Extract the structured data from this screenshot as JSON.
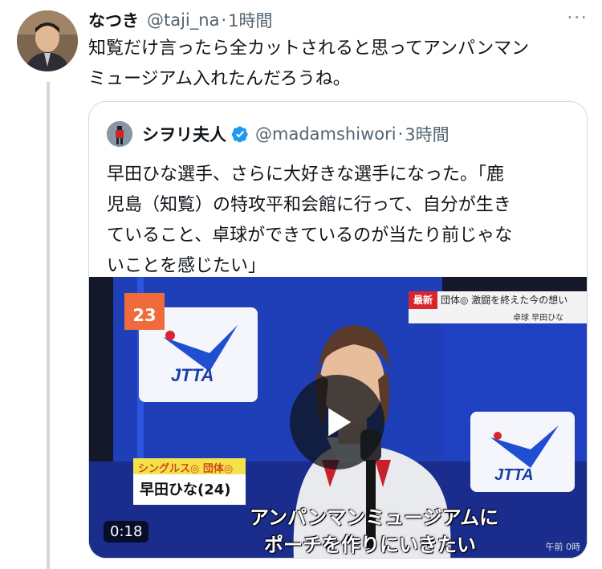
{
  "tweet": {
    "display_name": "なつき",
    "handle": "@taji_na",
    "separator": "·",
    "time": "1時間",
    "more_label": "···",
    "text_line1": "知覧だけ言ったら全カットされると思ってアンパンマン",
    "text_line2": "ミュージアム入れたんだろうね。"
  },
  "quote": {
    "display_name": "シヲリ夫人",
    "handle": "@madamshiwori",
    "separator": "·",
    "time": "3時間",
    "text_line1": "早田ひな選手、さらに大好きな選手になった。「鹿",
    "text_line2": "児島（知覧）の特攻平和会館に行って、自分が生き",
    "text_line3": "ていること、卓球ができているのが当たり前じゃな",
    "text_line4": "いことを感じたい」",
    "media": {
      "duration": "0:18",
      "subtitle_line1": "アンパンマンミュージアムに",
      "subtitle_line2": "ポーチを作りにいきたい",
      "name_plate_top": "シングルス◎ 団体◎",
      "name_plate": "早田ひな(24)",
      "badge": "23",
      "news_tag": "最新",
      "news_text": "団体◎ 激闘を終えた今の想い",
      "news_sub": "卓球 早田ひな",
      "logo_text": "JTTA",
      "corner_text": "午前 0時"
    }
  },
  "colors": {
    "verified": "#1d9bf0",
    "secondary_text": "#536471",
    "border": "#cfd9de"
  }
}
